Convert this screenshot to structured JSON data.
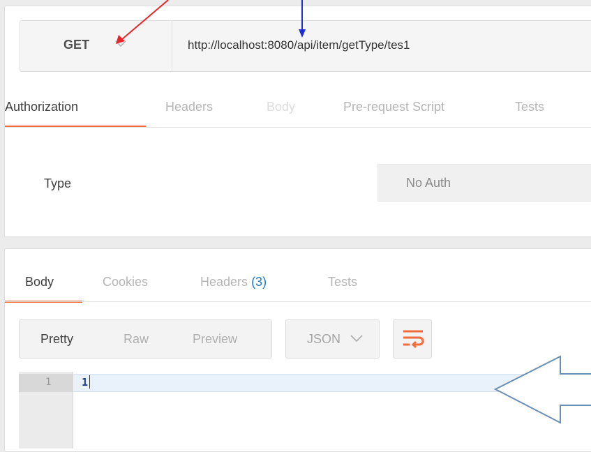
{
  "request": {
    "method": "GET",
    "url": "http://localhost:8080/api/item/getType/tes1",
    "tabs": [
      {
        "label": "Authorization",
        "state": "active"
      },
      {
        "label": "Headers",
        "state": "normal"
      },
      {
        "label": "Body",
        "state": "disabled"
      },
      {
        "label": "Pre-request Script",
        "state": "normal"
      },
      {
        "label": "Tests",
        "state": "normal"
      }
    ],
    "auth": {
      "type_label": "Type",
      "type_value": "No Auth"
    }
  },
  "response": {
    "tabs": [
      {
        "label": "Body",
        "state": "active"
      },
      {
        "label": "Cookies",
        "state": "normal"
      },
      {
        "label": "Headers",
        "count": "(3)",
        "state": "normal"
      },
      {
        "label": "Tests",
        "state": "normal"
      }
    ],
    "view_modes": [
      {
        "label": "Pretty",
        "state": "active"
      },
      {
        "label": "Raw",
        "state": "normal"
      },
      {
        "label": "Preview",
        "state": "normal"
      }
    ],
    "format": "JSON",
    "editor": {
      "line_number": "1",
      "content": "1"
    }
  },
  "colors": {
    "accent": "#f26b3a",
    "count": "#1a7ad0",
    "annotation_red": "#e8262a",
    "annotation_blue": "#1d2fd8",
    "annotation_arrow": "#6a8fb5"
  },
  "icons": [
    "chevron-down-icon",
    "wrap-lines-icon"
  ]
}
